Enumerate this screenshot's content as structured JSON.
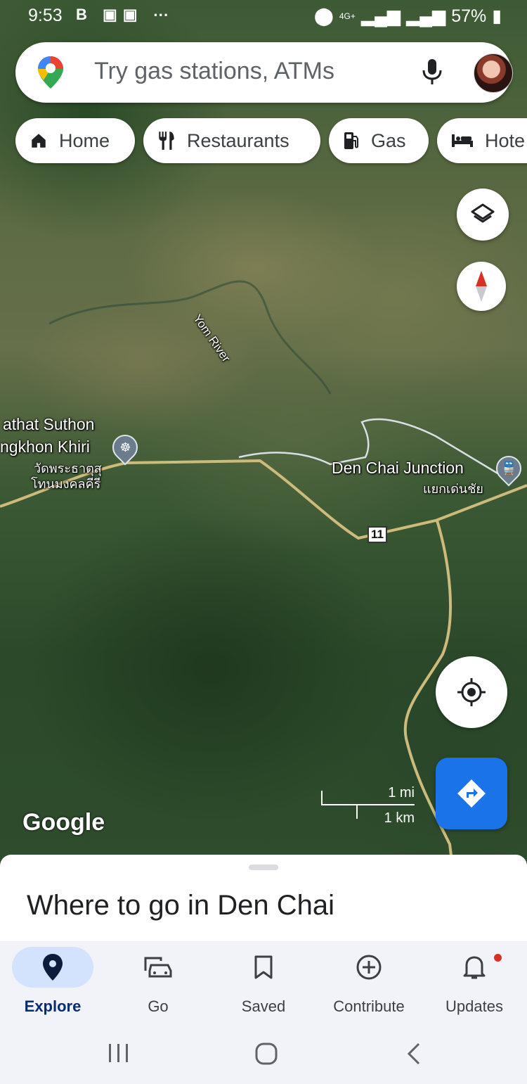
{
  "status_bar": {
    "time": "9:53",
    "left_icons": "B",
    "network": "4G+",
    "battery": "57%"
  },
  "search": {
    "placeholder": "Try gas stations, ATMs"
  },
  "chips": [
    {
      "label": "Home",
      "icon": "home-icon"
    },
    {
      "label": "Restaurants",
      "icon": "restaurant-icon"
    },
    {
      "label": "Gas",
      "icon": "gas-station-icon"
    },
    {
      "label": "Hote",
      "icon": "hotel-icon"
    }
  ],
  "map": {
    "labels": {
      "river": "Yom River",
      "temple_en_1": "athat Suthon",
      "temple_en_2": "ngkhon Khiri",
      "temple_th_1": "วัดพระธาตุสุ",
      "temple_th_2": "โทนมงคลคีรี",
      "junction_en": "Den Chai Junction",
      "junction_th": "แยกเด่นชัย",
      "route": "11"
    },
    "scale": {
      "mi": "1 mi",
      "km": "1 km"
    },
    "attribution": "Google"
  },
  "sheet": {
    "title": "Where to go in Den Chai"
  },
  "nav": [
    {
      "label": "Explore",
      "icon": "explore-pin-icon",
      "active": true
    },
    {
      "label": "Go",
      "icon": "car-icon"
    },
    {
      "label": "Saved",
      "icon": "bookmark-icon"
    },
    {
      "label": "Contribute",
      "icon": "add-circle-icon"
    },
    {
      "label": "Updates",
      "icon": "bell-icon"
    }
  ],
  "colors": {
    "accent": "#1a73e8",
    "active_nav_bg": "#d3e3fd",
    "notification_dot": "#d93025"
  }
}
